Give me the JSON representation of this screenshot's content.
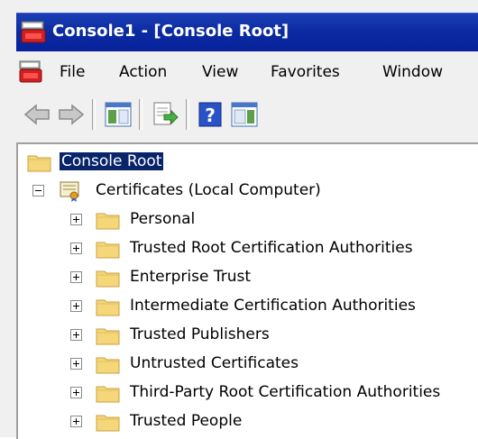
{
  "window": {
    "title": "Console1 - [Console Root]"
  },
  "menubar": {
    "items": [
      "File",
      "Action",
      "View",
      "Favorites",
      "Window"
    ]
  },
  "toolbar": {
    "buttons": [
      "back-arrow-icon",
      "forward-arrow-icon",
      "show-hide-console-tree-icon",
      "export-list-icon",
      "help-icon",
      "show-hide-action-pane-icon"
    ]
  },
  "tree": {
    "root": "Console Root",
    "snapin": "Certificates (Local Computer)",
    "stores": [
      "Personal",
      "Trusted Root Certification Authorities",
      "Enterprise Trust",
      "Intermediate Certification Authorities",
      "Trusted Publishers",
      "Untrusted Certificates",
      "Third-Party Root Certification Authorities",
      "Trusted People"
    ]
  },
  "colors": {
    "titlebar": "#0b2aa2",
    "selection": "#0a246a",
    "folder": "#f5d77a"
  }
}
